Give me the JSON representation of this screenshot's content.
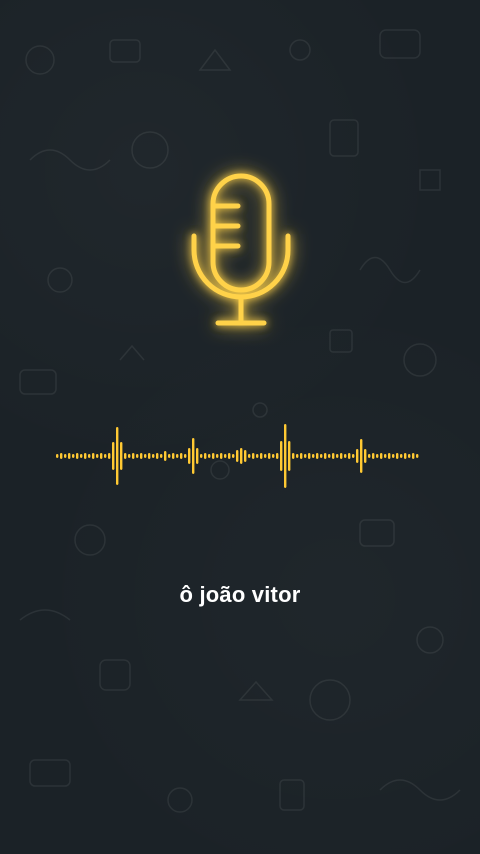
{
  "caption": {
    "text": "ô joão vitor"
  },
  "colors": {
    "background": "#1b2227",
    "neon": "#ffcc33",
    "neon_glow": "#ffb300",
    "caption": "#ffffff"
  },
  "icons": {
    "center": "microphone-icon",
    "audio": "audio-waveform"
  }
}
